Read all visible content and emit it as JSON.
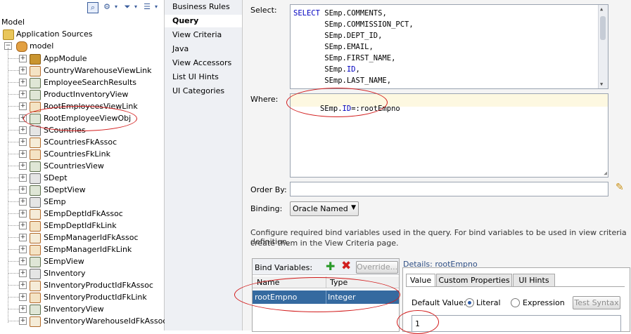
{
  "left_panel": {
    "root_label": "Model",
    "app_sources_label": "Application Sources",
    "package_label": "model",
    "items": [
      {
        "label": "AppModule",
        "icon": "app-module-icon"
      },
      {
        "label": "CountryWarehouseViewLink",
        "icon": "view-link-icon"
      },
      {
        "label": "EmployeeSearchResults",
        "icon": "view-object-icon"
      },
      {
        "label": "ProductInventoryView",
        "icon": "view-object-icon"
      },
      {
        "label": "RootEmployeesViewLink",
        "icon": "view-link-icon"
      },
      {
        "label": "RootEmployeeViewObj",
        "icon": "view-object-icon"
      },
      {
        "label": "SCountries",
        "icon": "entity-object-icon"
      },
      {
        "label": "SCountriesFkAssoc",
        "icon": "association-icon"
      },
      {
        "label": "SCountriesFkLink",
        "icon": "view-link-icon"
      },
      {
        "label": "SCountriesView",
        "icon": "view-object-icon"
      },
      {
        "label": "SDept",
        "icon": "entity-object-icon"
      },
      {
        "label": "SDeptView",
        "icon": "view-object-icon"
      },
      {
        "label": "SEmp",
        "icon": "entity-object-icon"
      },
      {
        "label": "SEmpDeptIdFkAssoc",
        "icon": "association-icon"
      },
      {
        "label": "SEmpDeptIdFkLink",
        "icon": "view-link-icon"
      },
      {
        "label": "SEmpManagerIdFkAssoc",
        "icon": "association-icon"
      },
      {
        "label": "SEmpManagerIdFkLink",
        "icon": "view-link-icon"
      },
      {
        "label": "SEmpView",
        "icon": "view-object-icon"
      },
      {
        "label": "SInventory",
        "icon": "entity-object-icon"
      },
      {
        "label": "SInventoryProductIdFkAssoc",
        "icon": "association-icon"
      },
      {
        "label": "SInventoryProductIdFkLink",
        "icon": "view-link-icon"
      },
      {
        "label": "SInventoryView",
        "icon": "view-object-icon"
      },
      {
        "label": "SInventoryWarehouseIdFkAssoc",
        "icon": "association-icon"
      }
    ]
  },
  "nav": {
    "items": [
      "Business Rules",
      "Query",
      "View Criteria",
      "Java",
      "View Accessors",
      "List UI Hints",
      "UI Categories"
    ],
    "selected": "Query"
  },
  "query": {
    "select_label": "Select:",
    "select_lines": [
      {
        "kw": "SELECT",
        "text": " SEmp.COMMENTS,"
      },
      {
        "kw": "",
        "text": "       SEmp.COMMISSION_PCT,"
      },
      {
        "kw": "",
        "text": "       SEmp.DEPT_ID,"
      },
      {
        "kw": "",
        "text": "       SEmp.EMAIL,"
      },
      {
        "kw": "",
        "text": "       SEmp.FIRST_NAME,"
      },
      {
        "kw": "",
        "text": "       SEmp.ID,"
      },
      {
        "kw": "",
        "text": "       SEmp.LAST_NAME,"
      }
    ],
    "where_label": "Where:",
    "where_text": "SEmp.ID=:rootEmpno",
    "orderby_label": "Order By:",
    "orderby_value": "",
    "binding_label": "Binding:",
    "binding_value": "Oracle Named",
    "info_line1": "Configure required bind variables used in the query.  For bind variables to be used in view criteria definition,",
    "info_line2": "create them in the View Criteria page."
  },
  "bind_vars": {
    "title": "Bind Variables:",
    "override_label": "Override...",
    "columns": [
      "Name",
      "Type"
    ],
    "rows": [
      {
        "name": "rootEmpno",
        "type": "Integer"
      }
    ]
  },
  "details": {
    "title": "Details: rootEmpno",
    "tabs": [
      "Value",
      "Custom Properties",
      "UI Hints"
    ],
    "default_value_label": "Default Value:",
    "literal_label": "Literal",
    "expression_label": "Expression",
    "test_syntax_label": "Test Syntax",
    "value": "1"
  },
  "colors": {
    "selection": "#356aa0",
    "annotation_red": "#d21b1b",
    "sql_keyword": "#0000c0",
    "where_bg": "#fdf8e1"
  }
}
